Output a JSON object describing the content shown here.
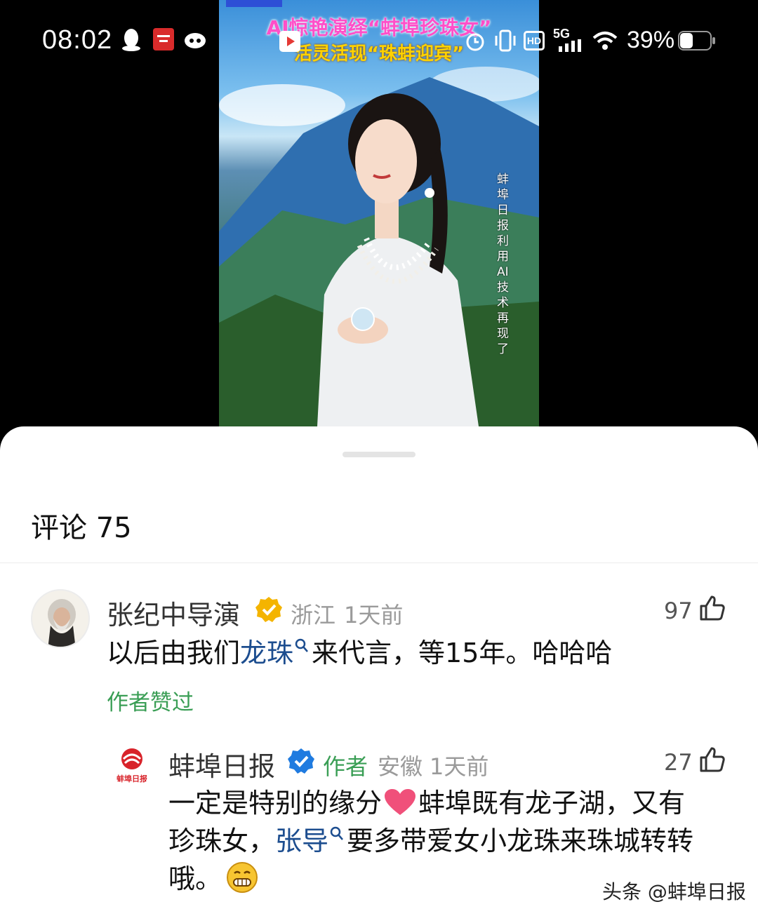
{
  "status_bar": {
    "time": "08:02",
    "network": "5G",
    "hd_label": "HD",
    "battery_percent": "39%",
    "icons": [
      "qq-icon",
      "study-app-icon",
      "cat-app-icon",
      "video-app-icon",
      "alarm-icon",
      "vibrate-icon",
      "hd-icon",
      "signal-icon",
      "wifi-icon",
      "battery-icon"
    ]
  },
  "video": {
    "title_line1": "AI惊艳演绎“蚌埠珍珠女”",
    "title_line2": "活灵活现“珠蚌迎宾”",
    "vertical_caption": "蚌埠日报利用AI技术再现了"
  },
  "comments_panel": {
    "title": "评论 75",
    "comments": [
      {
        "user": "张纪中导演",
        "location": "浙江",
        "time": "1天前",
        "likes": "97",
        "text_before": "以后由我们",
        "link_text": "龙珠",
        "text_after": "来代言，等15年。哈哈哈",
        "liked_by_author": "作者赞过"
      },
      {
        "user": "蚌埠日报",
        "author_tag": "作者",
        "location": "安徽",
        "time": "1天前",
        "likes": "27",
        "avatar_text": "蚌埠日报",
        "text_before": "一定是特别的缘分",
        "text_mid": "蚌埠既有龙子湖，又有",
        "text_line2_before": "珍珠女，",
        "link_text": "张导",
        "text_line2_after": "要多带爱女小龙珠来珠城转转",
        "text_line3": "哦。"
      }
    ]
  },
  "watermark": "头条 @蚌埠日报",
  "colors": {
    "link": "#1c4d8f",
    "green": "#3a9e55",
    "gold_badge": "#f4b400",
    "blue_badge": "#1f7be0"
  }
}
